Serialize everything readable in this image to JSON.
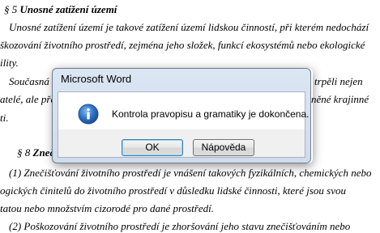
{
  "document": {
    "lines": [
      {
        "prefix": "§ 5 ",
        "heading": "Unosné zatížení území",
        "text": ""
      },
      {
        "text": "Unosné zatížení území je takové zatížení území lidskou činností, při kterém nedochází"
      },
      {
        "text": "škozování životního prostředí, zejména jeho složek, funkcí ekosystémů nebo ekologické"
      },
      {
        "text": "ility."
      },
      {
        "text": "Současná",
        "right": "ňš, trpěli nejen"
      },
      {
        "text": "atelé, ale pře",
        "right": "něné krajinné"
      },
      {
        "text": "ti."
      },
      {
        "prefix": "§ 8 ",
        "heading": "Znečiš",
        "text": ""
      },
      {
        "text": "(1) Znečišťování životního prostředí je vnášení takových fyzikálních, chemických nebo"
      },
      {
        "text": "ogických činitelů do životního prostředí v důsledku lidské činnosti, které jsou svou"
      },
      {
        "text": "tatou nebo množstvím cizorodé pro dané prostředí."
      },
      {
        "text": "(2) Poškozování životního prostředí je zhoršování jeho stavu znečišťováním nebo"
      }
    ]
  },
  "dialog": {
    "title": "Microsoft Word",
    "message": "Kontrola pravopisu a gramatiky je dokončena.",
    "icon": "info-icon",
    "ok_label": "OK",
    "help_label": "Nápověda"
  }
}
